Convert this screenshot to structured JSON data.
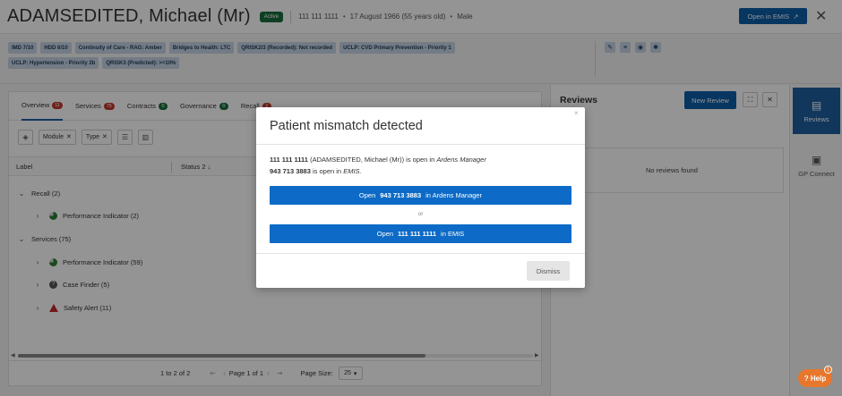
{
  "header": {
    "patient_name": "ADAMSEDITED, Michael (Mr)",
    "status_badge": "Active",
    "nhs_number": "111 111 1111",
    "dob": "17 August 1966 (55 years old)",
    "gender": "Male",
    "open_emis_label": "Open in EMIS",
    "close_glyph": "✕"
  },
  "tags": [
    "IMD 7/10",
    "HDD 6/10",
    "Continuity of Care - RAG: Amber",
    "Bridges to Health: LTC",
    "QRISK2/3 (Recorded): Not recorded",
    "UCLP: CVD Primary Prevention - Priority 1",
    "UCLP: Hypertension - Priority 2b",
    "QRISK3 (Predicted): >=10%"
  ],
  "tag_icons": [
    "edit-icon",
    "document-icon",
    "globe-icon",
    "settings-icon"
  ],
  "tabs": [
    {
      "label": "Overview",
      "count": "11",
      "color": "#c0392b"
    },
    {
      "label": "Services",
      "count": "75",
      "color": "#c0392b"
    },
    {
      "label": "Contracts",
      "count": "0",
      "color": "#1b6d3d"
    },
    {
      "label": "Governance",
      "count": "0",
      "color": "#1b6d3d"
    },
    {
      "label": "Recall",
      "count": "2",
      "color": "#c0392b"
    }
  ],
  "toolbar": {
    "chip_module": "Module",
    "chip_type": "Type",
    "chip_remove": "✕"
  },
  "table": {
    "col_label": "Label",
    "col_status": "Status 2 ↓",
    "rows": [
      {
        "label": "Recall (2)",
        "level": 0,
        "icon": ""
      },
      {
        "label": "Performance Indicator (2)",
        "level": 1,
        "icon": "pi"
      },
      {
        "label": "Services (75)",
        "level": 0,
        "icon": ""
      },
      {
        "label": "Performance Indicator (59)",
        "level": 1,
        "icon": "pi"
      },
      {
        "label": "Case Finder (5)",
        "level": 1,
        "icon": "cf"
      },
      {
        "label": "Safety Alert (11)",
        "level": 1,
        "icon": "sa"
      }
    ]
  },
  "pager": {
    "range": "1 to 2 of 2",
    "page": "Page 1 of 1",
    "page_size_label": "Page Size:",
    "page_size": "25"
  },
  "reviews": {
    "title": "Reviews",
    "new_review": "New Review",
    "sub": "t",
    "empty": "No reviews found"
  },
  "sidebar": {
    "reviews": "Reviews",
    "gp_connect": "GP Connect"
  },
  "modal": {
    "title": "Patient mismatch detected",
    "close": "×",
    "line1_num": "111 111 1111",
    "line1_text": "(ADAMSEDITED, Michael (Mr)) is open in",
    "line1_app": "Ardens Manager",
    "line2_num": "943 713 3883",
    "line2_text": "is open in",
    "line2_app": "EMIS.",
    "btn1_pre": "Open",
    "btn1_num": "943 713 3883",
    "btn1_post": "in Ardens Manager",
    "or": "or",
    "btn2_pre": "Open",
    "btn2_num": "111 111 1111",
    "btn2_post": "in EMIS",
    "dismiss": "Dismiss"
  },
  "help": {
    "label": "? Help",
    "count": "1"
  },
  "colors": {
    "brand_blue": "#0d5ea8",
    "button_blue": "#0d6bc7",
    "active_green": "#1b6d3d",
    "alert_red": "#c0392b",
    "tag_bg": "#c7d5e6",
    "help_orange": "#e8772e"
  }
}
